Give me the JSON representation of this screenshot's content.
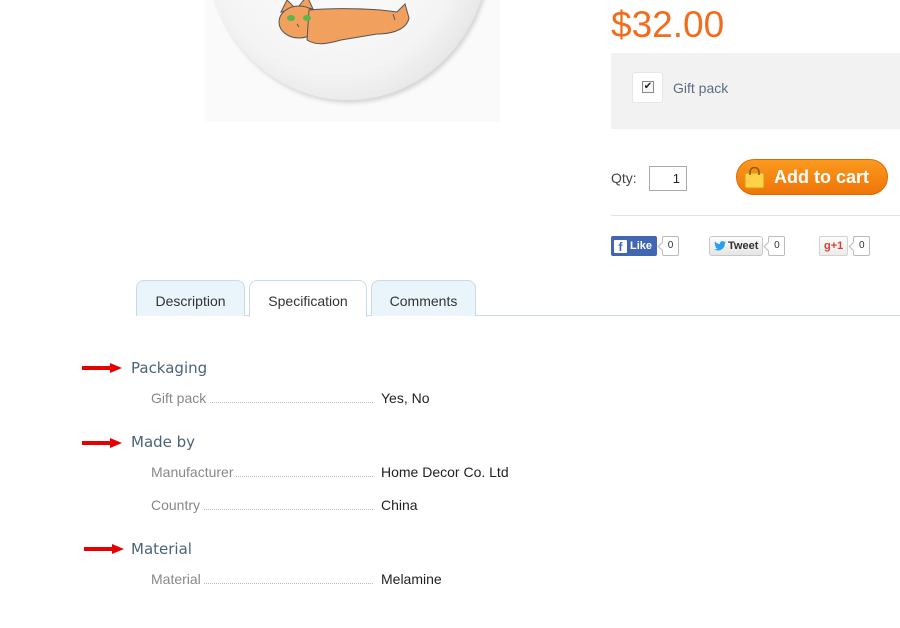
{
  "product": {
    "price": "$32.00",
    "image_alt": "cat plate"
  },
  "options": {
    "gift_pack_label": "Gift pack",
    "gift_pack_checked": true
  },
  "purchase": {
    "qty_label": "Qty:",
    "qty_value": "1",
    "add_to_cart_label": "Add to cart"
  },
  "social": {
    "like_label": "Like",
    "like_count": "0",
    "tweet_label": "Tweet",
    "tweet_count": "0",
    "gplus_label": "g+1",
    "gplus_count": "0"
  },
  "tabs": [
    {
      "label": "Description",
      "active": false
    },
    {
      "label": "Specification",
      "active": true
    },
    {
      "label": "Comments",
      "active": false
    }
  ],
  "specification": [
    {
      "group": "Packaging",
      "rows": [
        {
          "name": "Gift pack",
          "value": "Yes, No"
        }
      ]
    },
    {
      "group": "Made by",
      "rows": [
        {
          "name": "Manufacturer",
          "value": "Home Decor Co. Ltd"
        },
        {
          "name": "Country",
          "value": "China"
        }
      ]
    },
    {
      "group": "Material",
      "rows": [
        {
          "name": "Material",
          "value": "Melamine"
        }
      ]
    }
  ],
  "colors": {
    "price": "#f26c1d",
    "cart_button": "#f5870f",
    "annotation_arrow": "#e60000",
    "tab_bg": "#e9f4fb"
  }
}
